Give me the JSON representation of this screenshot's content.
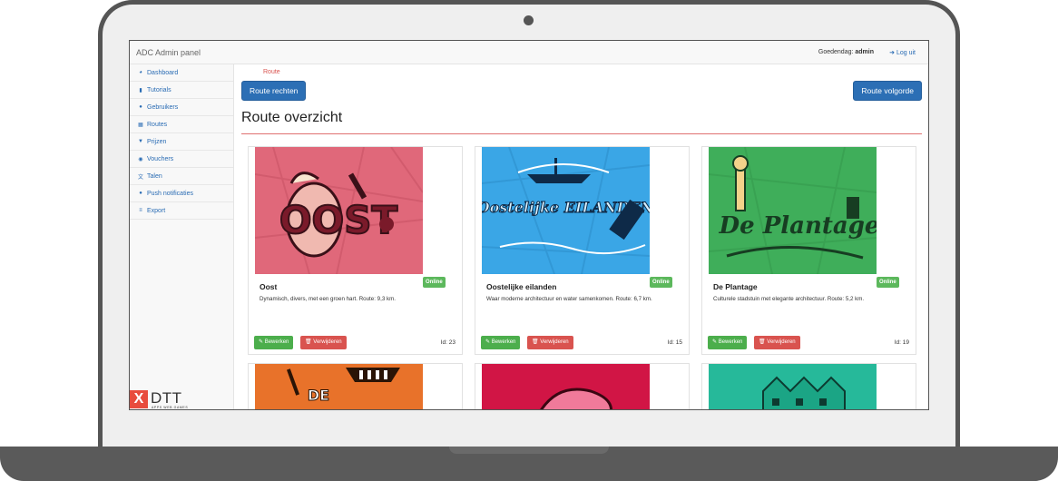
{
  "navbar": {
    "brand": "ADC Admin panel",
    "greeting_prefix": "Goedendag: ",
    "user": "admin",
    "logout_label": "Log uit"
  },
  "sidebar": {
    "items": [
      {
        "label": "Dashboard",
        "icon": "dashboard-icon"
      },
      {
        "label": "Tutorials",
        "icon": "book-icon"
      },
      {
        "label": "Gebruikers",
        "icon": "users-icon"
      },
      {
        "label": "Routes",
        "icon": "map-icon"
      },
      {
        "label": "Prijzen",
        "icon": "trophy-icon"
      },
      {
        "label": "Vouchers",
        "icon": "ticket-icon"
      },
      {
        "label": "Talen",
        "icon": "language-icon"
      },
      {
        "label": "Push notificaties",
        "icon": "comment-icon"
      },
      {
        "label": "Export",
        "icon": "database-icon"
      }
    ]
  },
  "logo": {
    "name": "DTT",
    "tagline": "APPS WEB GAMES",
    "mark": "X"
  },
  "main": {
    "breadcrumb": "Route",
    "btn_rights": "Route rechten",
    "btn_order": "Route volgorde",
    "heading": "Route overzicht"
  },
  "cards": [
    {
      "title": "Oost",
      "desc": "Dynamisch, divers, met een groen hart. Route: 9,3 km.",
      "status": "Online",
      "edit": "Bewerken",
      "delete": "Verwijderen",
      "id": "Id: 23",
      "color": "#e0687a",
      "art": "OOST"
    },
    {
      "title": "Oostelijke eilanden",
      "desc": "Waar moderne architectuur en water samenkomen. Route: 6,7 km.",
      "status": "Online",
      "edit": "Bewerken",
      "delete": "Verwijderen",
      "id": "Id: 15",
      "color": "#3aa6e6",
      "art": "Oostelijke EILANDEN"
    },
    {
      "title": "De Plantage",
      "desc": "Culturele stadstuin met elegante architectuur. Route: 5,2 km.",
      "status": "Online",
      "edit": "Bewerken",
      "delete": "Verwijderen",
      "id": "Id: 19",
      "color": "#3fae5a",
      "art": "De Plantage"
    }
  ],
  "cards_row2": [
    {
      "color": "#e8722a",
      "art": "DE"
    },
    {
      "color": "#d11545",
      "art": ""
    },
    {
      "color": "#26b99a",
      "art": ""
    }
  ]
}
